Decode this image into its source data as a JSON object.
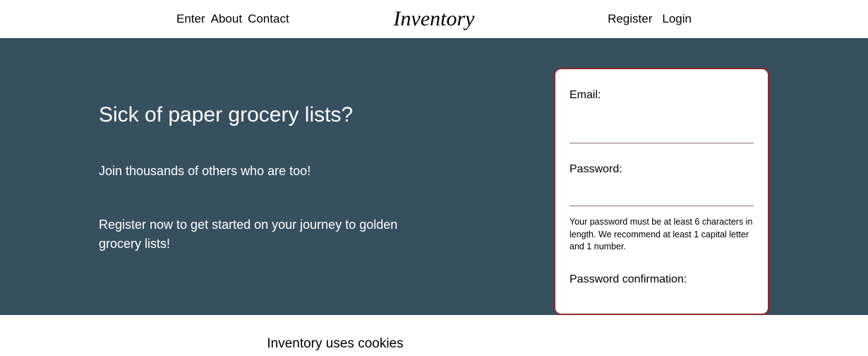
{
  "header": {
    "nav": {
      "enter": "Enter",
      "about": "About",
      "contact": "Contact"
    },
    "brand": "Inventory",
    "auth": {
      "register": "Register",
      "login": "Login"
    }
  },
  "hero": {
    "heading": "Sick of paper grocery lists?",
    "sub1": "Join thousands of others who are too!",
    "sub2": "Register now to get started on your journey to golden grocery lists!"
  },
  "form": {
    "email_label": "Email:",
    "password_label": "Password:",
    "password_helper": "Your password must be at least 6 characters in length. We recommend at least 1 capital letter and 1 number.",
    "confirm_label": "Password confirmation:"
  },
  "cookies": {
    "text": "Inventory uses cookies"
  }
}
